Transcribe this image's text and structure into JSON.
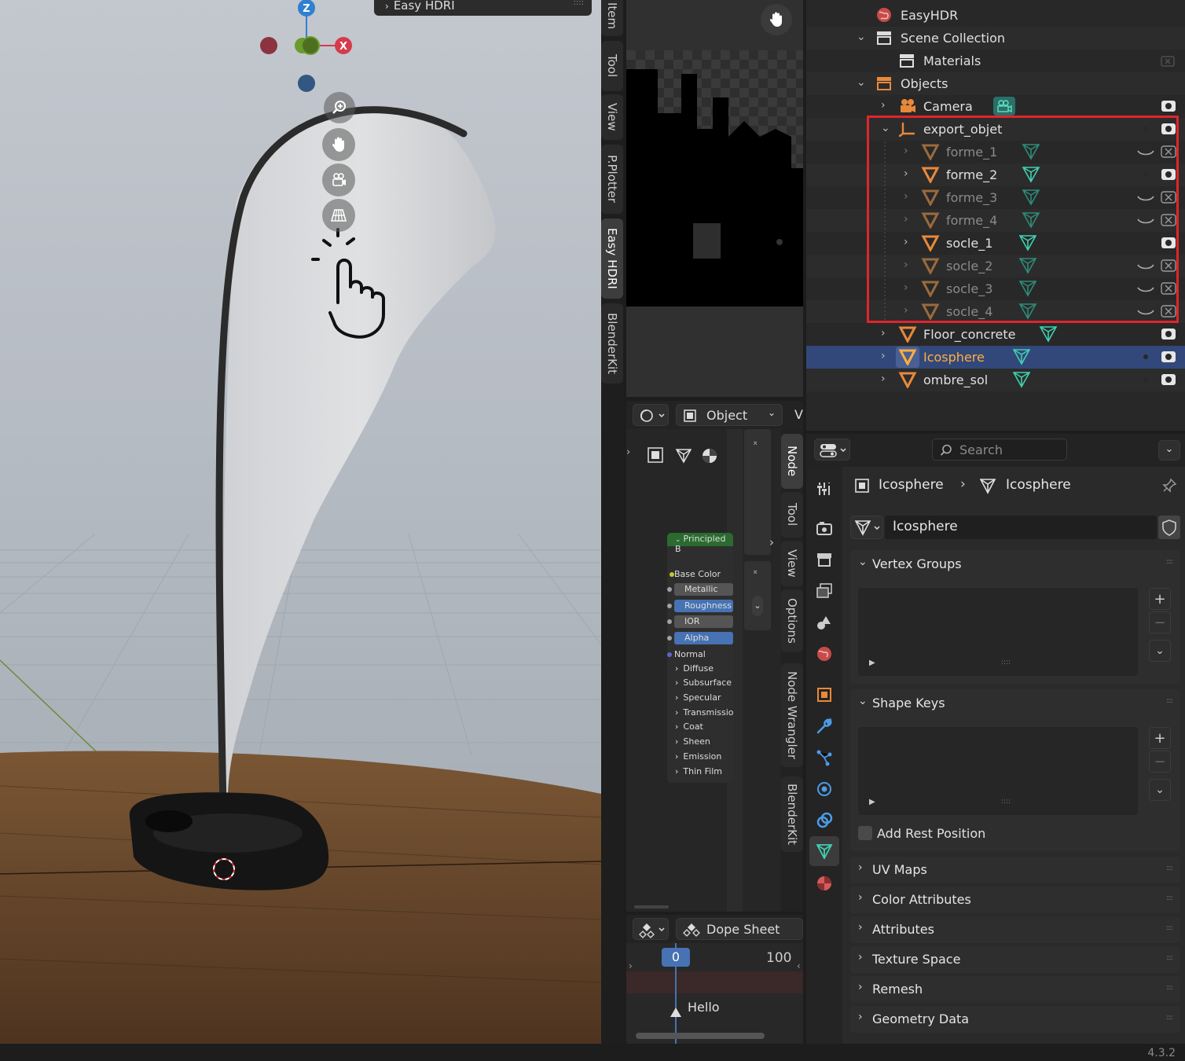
{
  "viewport": {
    "panel_header": "Easy HDRI",
    "gizmo": {
      "z": "Z",
      "x": "X",
      "colors": {
        "x": "#d63b4b",
        "y": "#6b9b2c",
        "z": "#2f80d0"
      }
    },
    "nav_icons": [
      "zoom-icon",
      "hand-pan-icon",
      "camera-view-icon",
      "perspective-grid-icon"
    ]
  },
  "n_panel_tabs": [
    "Item",
    "Tool",
    "View",
    "P.Plotter",
    "Easy HDRI",
    "BlenderKit"
  ],
  "node_editor": {
    "mode": "Object",
    "header_extra": "V",
    "tabs": [
      "Node",
      "Tool",
      "View",
      "Options",
      "Node Wrangler",
      "BlenderKit"
    ],
    "node": {
      "title": "Principled B",
      "inputs": [
        "Base Color",
        "Metallic",
        "Roughness",
        "IOR",
        "Alpha",
        "Normal"
      ],
      "panels": [
        "Diffuse",
        "Subsurface",
        "Specular",
        "Transmissio",
        "Coat",
        "Sheen",
        "Emission",
        "Thin Film"
      ]
    }
  },
  "dope_sheet": {
    "title": "Dope Sheet",
    "current_frame": "0",
    "end_frame": "100",
    "marker": "Hello"
  },
  "outliner": {
    "rows": [
      {
        "label": "EasyHDR"
      },
      {
        "label": "Scene Collection"
      },
      {
        "label": "Materials"
      },
      {
        "label": "Objects"
      },
      {
        "label": "Camera"
      },
      {
        "label": "export_objet"
      },
      {
        "label": "forme_1"
      },
      {
        "label": "forme_2"
      },
      {
        "label": "forme_3"
      },
      {
        "label": "forme_4"
      },
      {
        "label": "socle_1"
      },
      {
        "label": "socle_2"
      },
      {
        "label": "socle_3"
      },
      {
        "label": "socle_4"
      },
      {
        "label": "Floor_concrete"
      },
      {
        "label": "Icosphere"
      },
      {
        "label": "ombre_sol"
      }
    ],
    "highlight_color": "#e0242c",
    "selected_color": "#33487a",
    "active_text_color": "#ffae3d"
  },
  "properties": {
    "search_placeholder": "Search",
    "breadcrumb_object": "Icosphere",
    "breadcrumb_data": "Icosphere",
    "mesh_name": "Icosphere",
    "sections": {
      "vertex_groups": "Vertex Groups",
      "shape_keys": "Shape Keys",
      "add_rest_position": "Add Rest Position",
      "uv_maps": "UV Maps",
      "color_attributes": "Color Attributes",
      "attributes": "Attributes",
      "texture_space": "Texture Space",
      "remesh": "Remesh",
      "geometry_data": "Geometry Data"
    }
  },
  "status_bar": {
    "version": "4.3.2"
  }
}
